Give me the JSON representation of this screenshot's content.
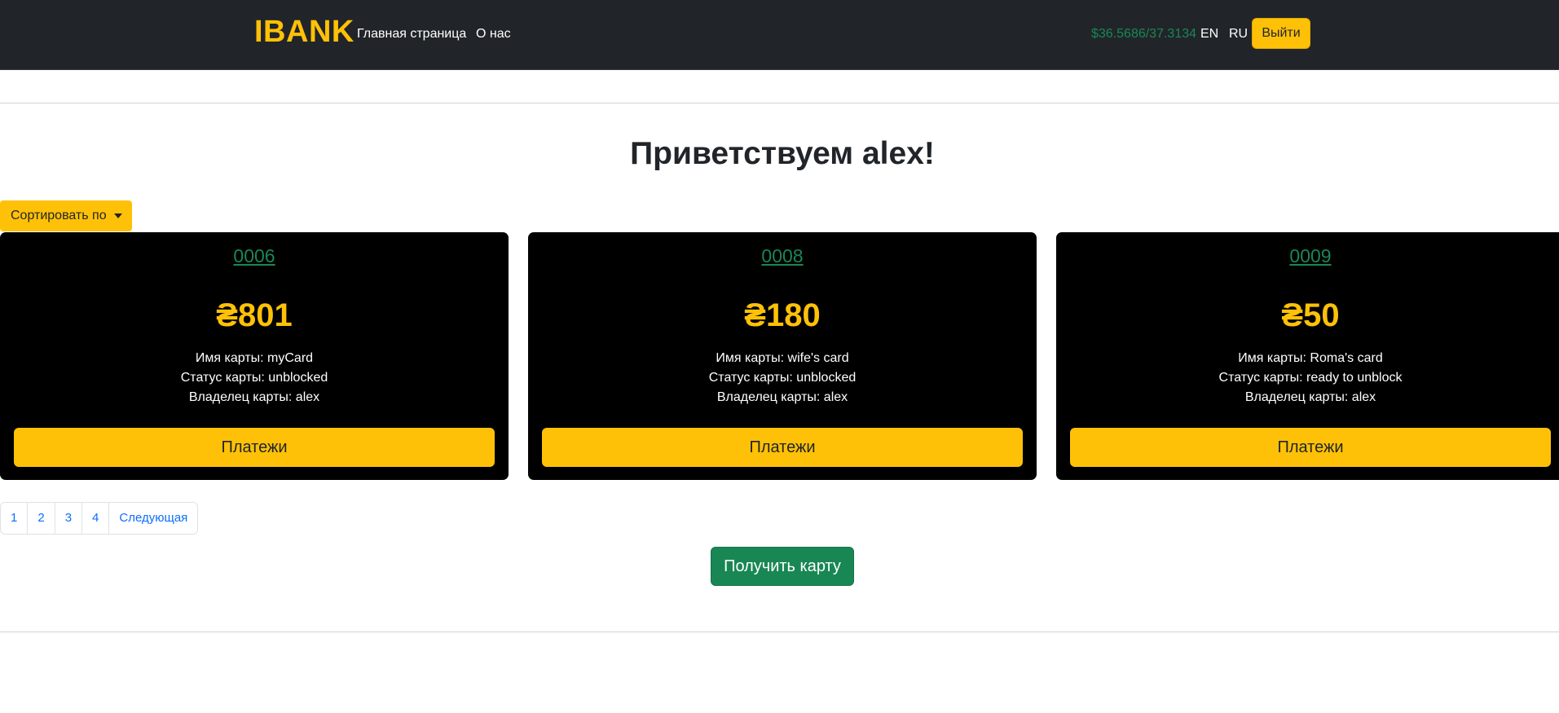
{
  "navbar": {
    "brand": "IBANK",
    "links": [
      {
        "label": "Главная страница"
      },
      {
        "label": "О нас"
      }
    ],
    "exchange_rate": "$36.5686/37.3134",
    "languages": [
      "EN",
      "RU"
    ],
    "logout_label": "Выйти"
  },
  "main": {
    "greeting": "Приветствуем alex!",
    "sort_label": "Сортировать по",
    "cards": [
      {
        "number": "0006",
        "balance": "₴801",
        "name_line": "Имя карты: myCard",
        "status_line": "Статус карты: unblocked",
        "owner_line": "Владелец карты: alex",
        "button_label": "Платежи"
      },
      {
        "number": "0008",
        "balance": "₴180",
        "name_line": "Имя карты: wife's card",
        "status_line": "Статус карты: unblocked",
        "owner_line": "Владелец карты: alex",
        "button_label": "Платежи"
      },
      {
        "number": "0009",
        "balance": "₴50",
        "name_line": "Имя карты: Roma's card",
        "status_line": "Статус карты: ready to unblock",
        "owner_line": "Владелец карты: alex",
        "button_label": "Платежи"
      }
    ],
    "pagination": {
      "pages": [
        "1",
        "2",
        "3",
        "4"
      ],
      "next_label": "Следующая"
    },
    "get_card_label": "Получить карту"
  },
  "colors": {
    "navbar_bg": "#212529",
    "accent_yellow": "#ffc107",
    "success_green": "#198754",
    "link_blue": "#0d6efd",
    "card_bg": "#000000"
  },
  "icons": {
    "sort_dropdown": "caret-down-icon"
  }
}
